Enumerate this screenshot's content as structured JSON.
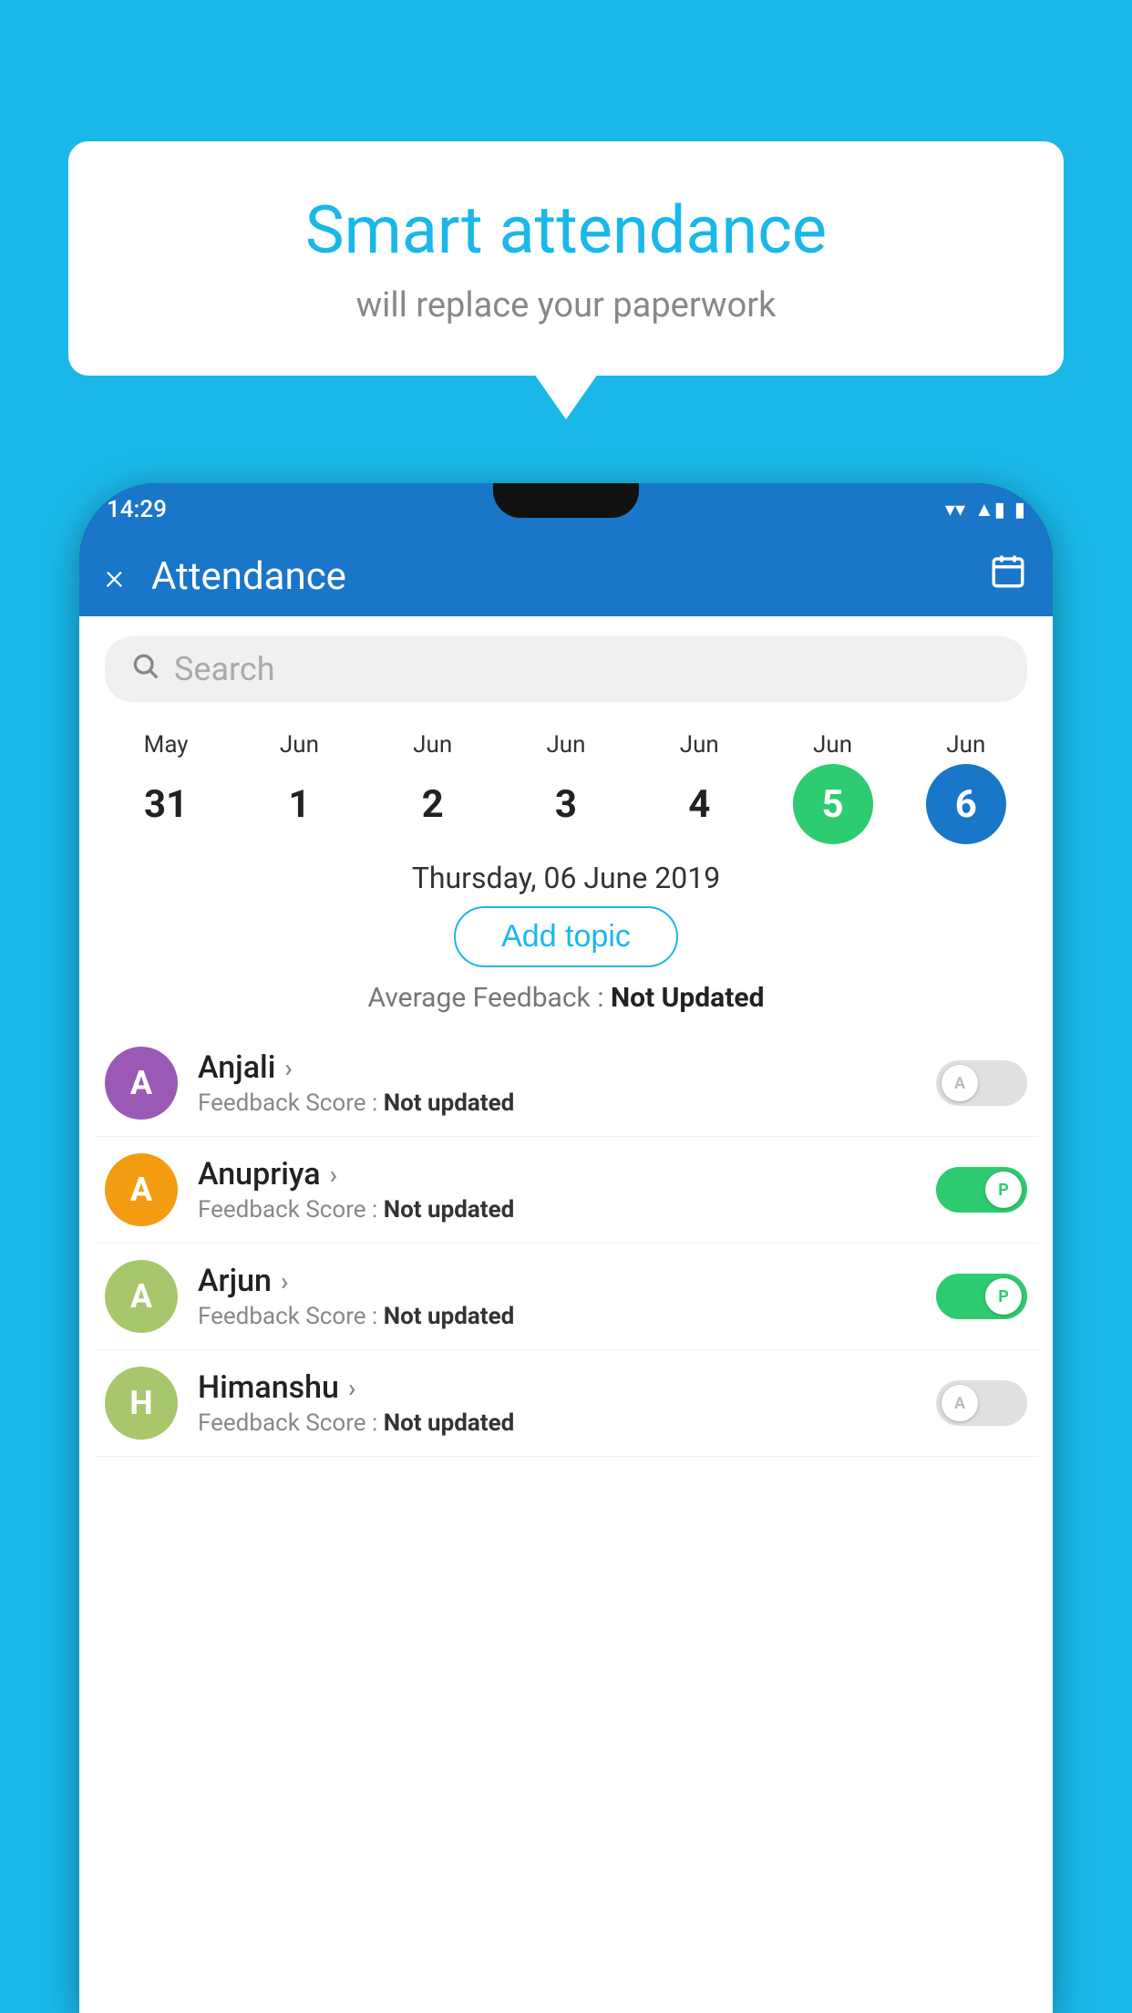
{
  "background_color": "#1ab8e8",
  "bubble": {
    "title": "Smart attendance",
    "subtitle": "will replace your paperwork"
  },
  "status_bar": {
    "time": "14:29",
    "icons": [
      "▼",
      "◀",
      "▮"
    ]
  },
  "app_bar": {
    "title": "Attendance",
    "close_label": "×",
    "calendar_icon": "📅"
  },
  "search": {
    "placeholder": "Search"
  },
  "calendar": {
    "columns": [
      {
        "month": "May",
        "day": "31",
        "highlight": ""
      },
      {
        "month": "Jun",
        "day": "1",
        "highlight": ""
      },
      {
        "month": "Jun",
        "day": "2",
        "highlight": ""
      },
      {
        "month": "Jun",
        "day": "3",
        "highlight": ""
      },
      {
        "month": "Jun",
        "day": "4",
        "highlight": ""
      },
      {
        "month": "Jun",
        "day": "5",
        "highlight": "green"
      },
      {
        "month": "Jun",
        "day": "6",
        "highlight": "blue"
      }
    ]
  },
  "selected_date": "Thursday, 06 June 2019",
  "add_topic_label": "Add topic",
  "avg_feedback_label": "Average Feedback :",
  "avg_feedback_value": "Not Updated",
  "students": [
    {
      "name": "Anjali",
      "avatar_letter": "A",
      "avatar_color": "#9b59b6",
      "feedback_label": "Feedback Score :",
      "feedback_value": "Not updated",
      "toggle": "off",
      "toggle_letter": "A"
    },
    {
      "name": "Anupriya",
      "avatar_letter": "A",
      "avatar_color": "#f39c12",
      "feedback_label": "Feedback Score :",
      "feedback_value": "Not updated",
      "toggle": "on",
      "toggle_letter": "P"
    },
    {
      "name": "Arjun",
      "avatar_letter": "A",
      "avatar_color": "#a8c66c",
      "feedback_label": "Feedback Score :",
      "feedback_value": "Not updated",
      "toggle": "on",
      "toggle_letter": "P"
    },
    {
      "name": "Himanshu",
      "avatar_letter": "H",
      "avatar_color": "#a8c66c",
      "feedback_label": "Feedback Score :",
      "feedback_value": "Not updated",
      "toggle": "off",
      "toggle_letter": "A"
    }
  ]
}
